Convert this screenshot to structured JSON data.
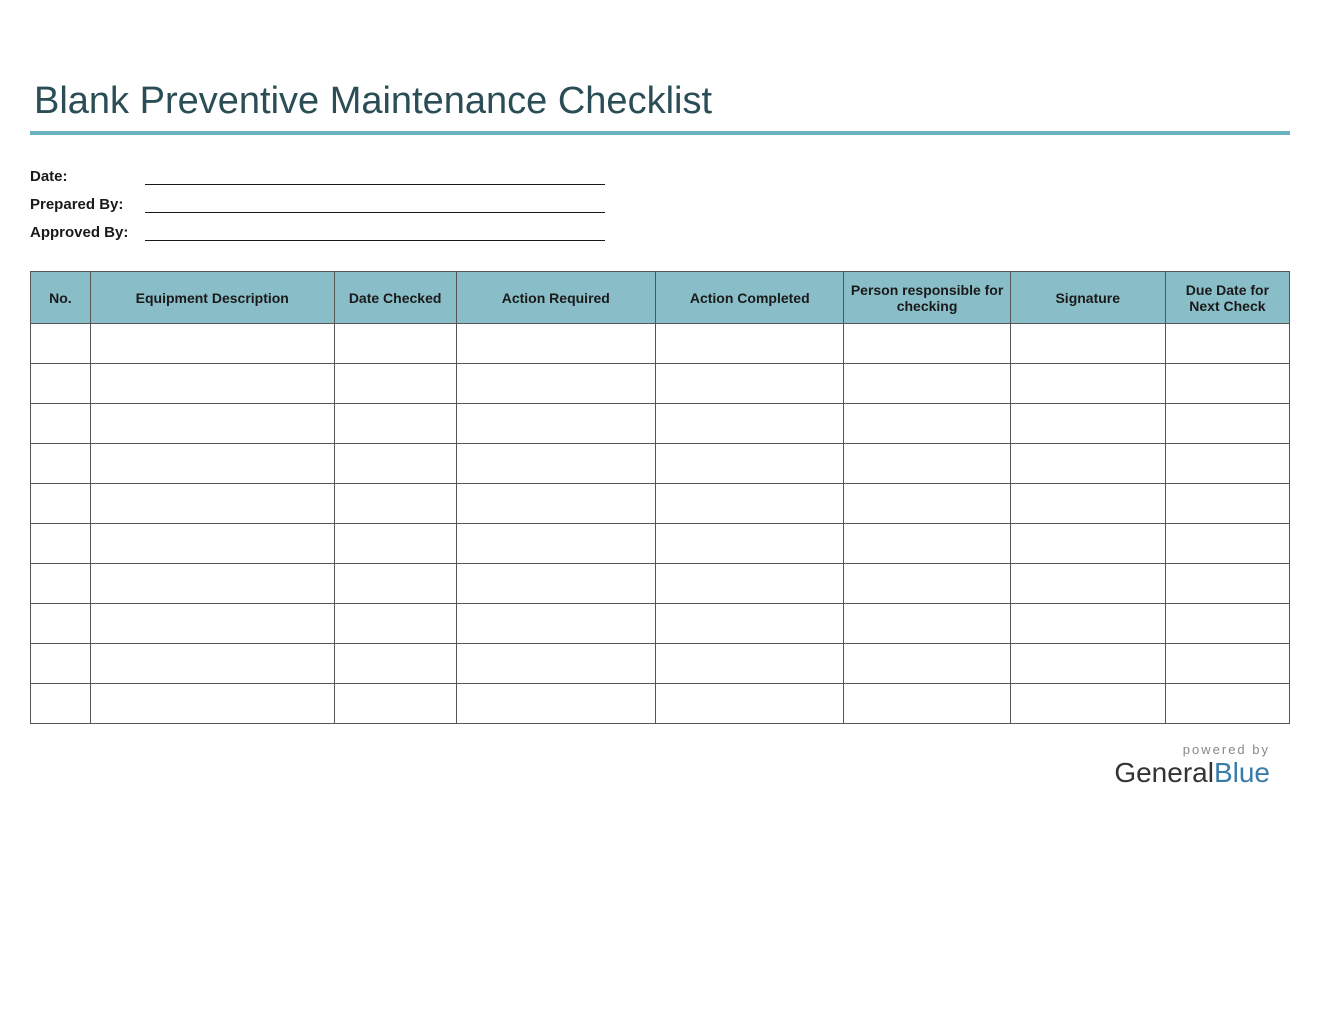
{
  "title": "Blank Preventive Maintenance Checklist",
  "meta": {
    "date_label": "Date:",
    "prepared_by_label": "Prepared By:",
    "approved_by_label": "Approved By:",
    "date_value": "",
    "prepared_by_value": "",
    "approved_by_value": ""
  },
  "table": {
    "headers": {
      "no": "No.",
      "equipment_description": "Equipment Description",
      "date_checked": "Date Checked",
      "action_required": "Action Required",
      "action_completed": "Action Completed",
      "person_responsible": "Person responsible for checking",
      "signature": "Signature",
      "due_date": "Due Date for Next Check"
    },
    "row_count": 10
  },
  "footer": {
    "powered_by": "powered by",
    "brand_general": "General",
    "brand_blue": "Blue"
  },
  "colors": {
    "accent": "#6bb2c0",
    "header_bg": "#89bdc7",
    "title_color": "#2a4d56"
  }
}
